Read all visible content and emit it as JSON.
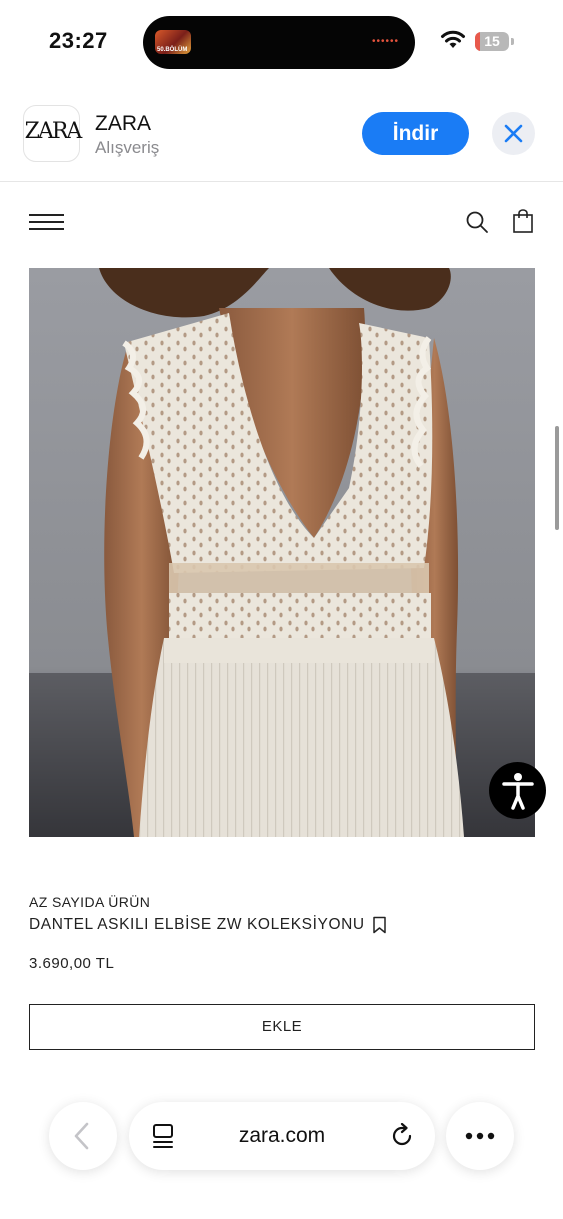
{
  "status_bar": {
    "time": "23:27",
    "battery_level": "15",
    "battery_fraction": 0.15,
    "live_activity_icon": "tv-show-thumbnail",
    "live_activity_badge": "50.BÖLÜM"
  },
  "app_banner": {
    "app_name": "ZARA",
    "app_category": "Alışveriş",
    "logo_text": "ZARA",
    "get_label": "İndir",
    "accent_color": "#1a7cf5"
  },
  "site_header": {
    "menu_icon": "hamburger-menu-icon",
    "search_icon": "search-icon",
    "bag_icon": "shopping-bag-icon"
  },
  "product": {
    "image_description_icon": "product-photo",
    "stock_label": "AZ SAYIDA ÜRÜN",
    "name": "DANTEL ASKILI ELBİSE ZW KOLEKSİYONU",
    "price": "3.690,00 TL",
    "add_label": "EKLE"
  },
  "browser": {
    "url": "zara.com",
    "back_icon": "chevron-left-icon",
    "reader_icon": "reader-mode-icon",
    "reload_icon": "reload-icon",
    "more_icon": "more-icon"
  }
}
